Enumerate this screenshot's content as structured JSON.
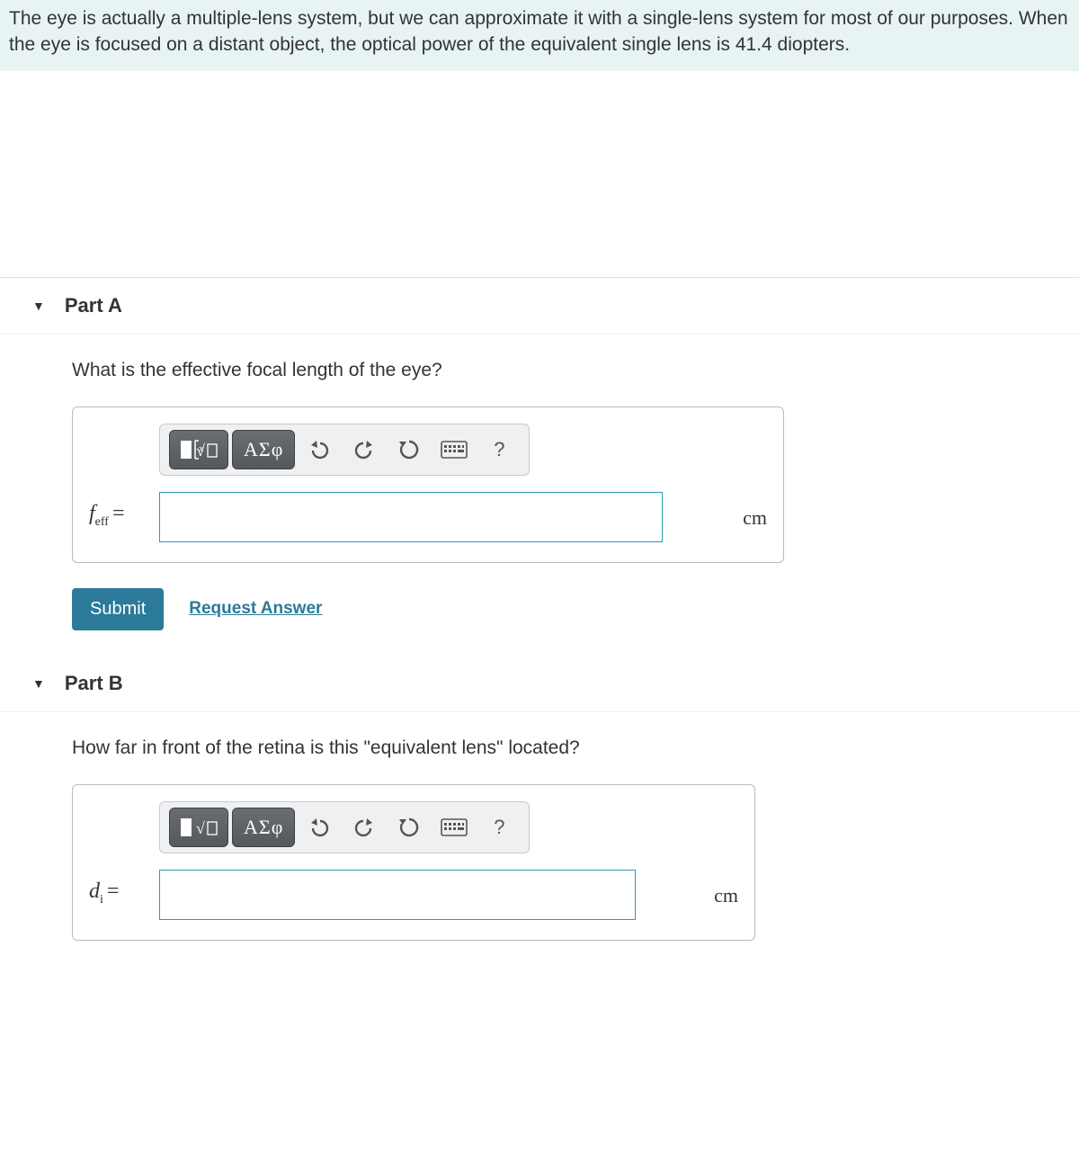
{
  "intro": "The eye is actually a multiple-lens system, but we can approximate it with a single-lens system for most of our purposes. When the eye is focused on a distant object, the optical power of the equivalent single lens is 41.4 diopters.",
  "partA": {
    "title": "Part A",
    "question": "What is the effective focal length of the eye?",
    "varSymbol": "f",
    "varSub": "eff",
    "equals": "=",
    "value": "",
    "unit": "cm",
    "toolbar": {
      "greek": "ΑΣφ",
      "help": "?"
    },
    "submit": "Submit",
    "request": "Request Answer"
  },
  "partB": {
    "title": "Part B",
    "question": "How far in front of the retina is this \"equivalent lens\" located?",
    "varSymbol": "d",
    "varSub": "i",
    "equals": "=",
    "value": "",
    "unit": "cm",
    "toolbar": {
      "greek": "ΑΣφ",
      "help": "?"
    }
  }
}
